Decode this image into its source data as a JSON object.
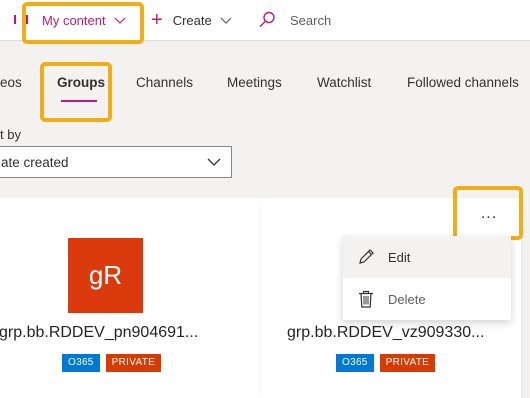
{
  "topbar": {
    "my_content_label": "My content",
    "create_label": "Create",
    "search_label": "Search",
    "accent_color": "#bc1a78"
  },
  "tabs": [
    {
      "label": "eos"
    },
    {
      "label": "Groups",
      "active": true
    },
    {
      "label": "Channels"
    },
    {
      "label": "Meetings"
    },
    {
      "label": "Watchlist"
    },
    {
      "label": "Followed channels"
    }
  ],
  "sort": {
    "label": "t by",
    "value": "ate created"
  },
  "cards": [
    {
      "avatar_text": "gR",
      "avatar_color": "#db3a0d",
      "title": "grp.bb.RDDEV_pn904691...",
      "badges": [
        "O365",
        "PRIVATE"
      ]
    },
    {
      "title": "grp.bb.RDDEV_vz909330...",
      "badges": [
        "O365",
        "PRIVATE"
      ]
    }
  ],
  "card_menu": {
    "more_label": "...",
    "items": [
      {
        "label": "Edit",
        "icon": "pencil-icon"
      },
      {
        "label": "Delete",
        "icon": "trash-icon"
      }
    ]
  },
  "highlight_color": "#f1ae14"
}
